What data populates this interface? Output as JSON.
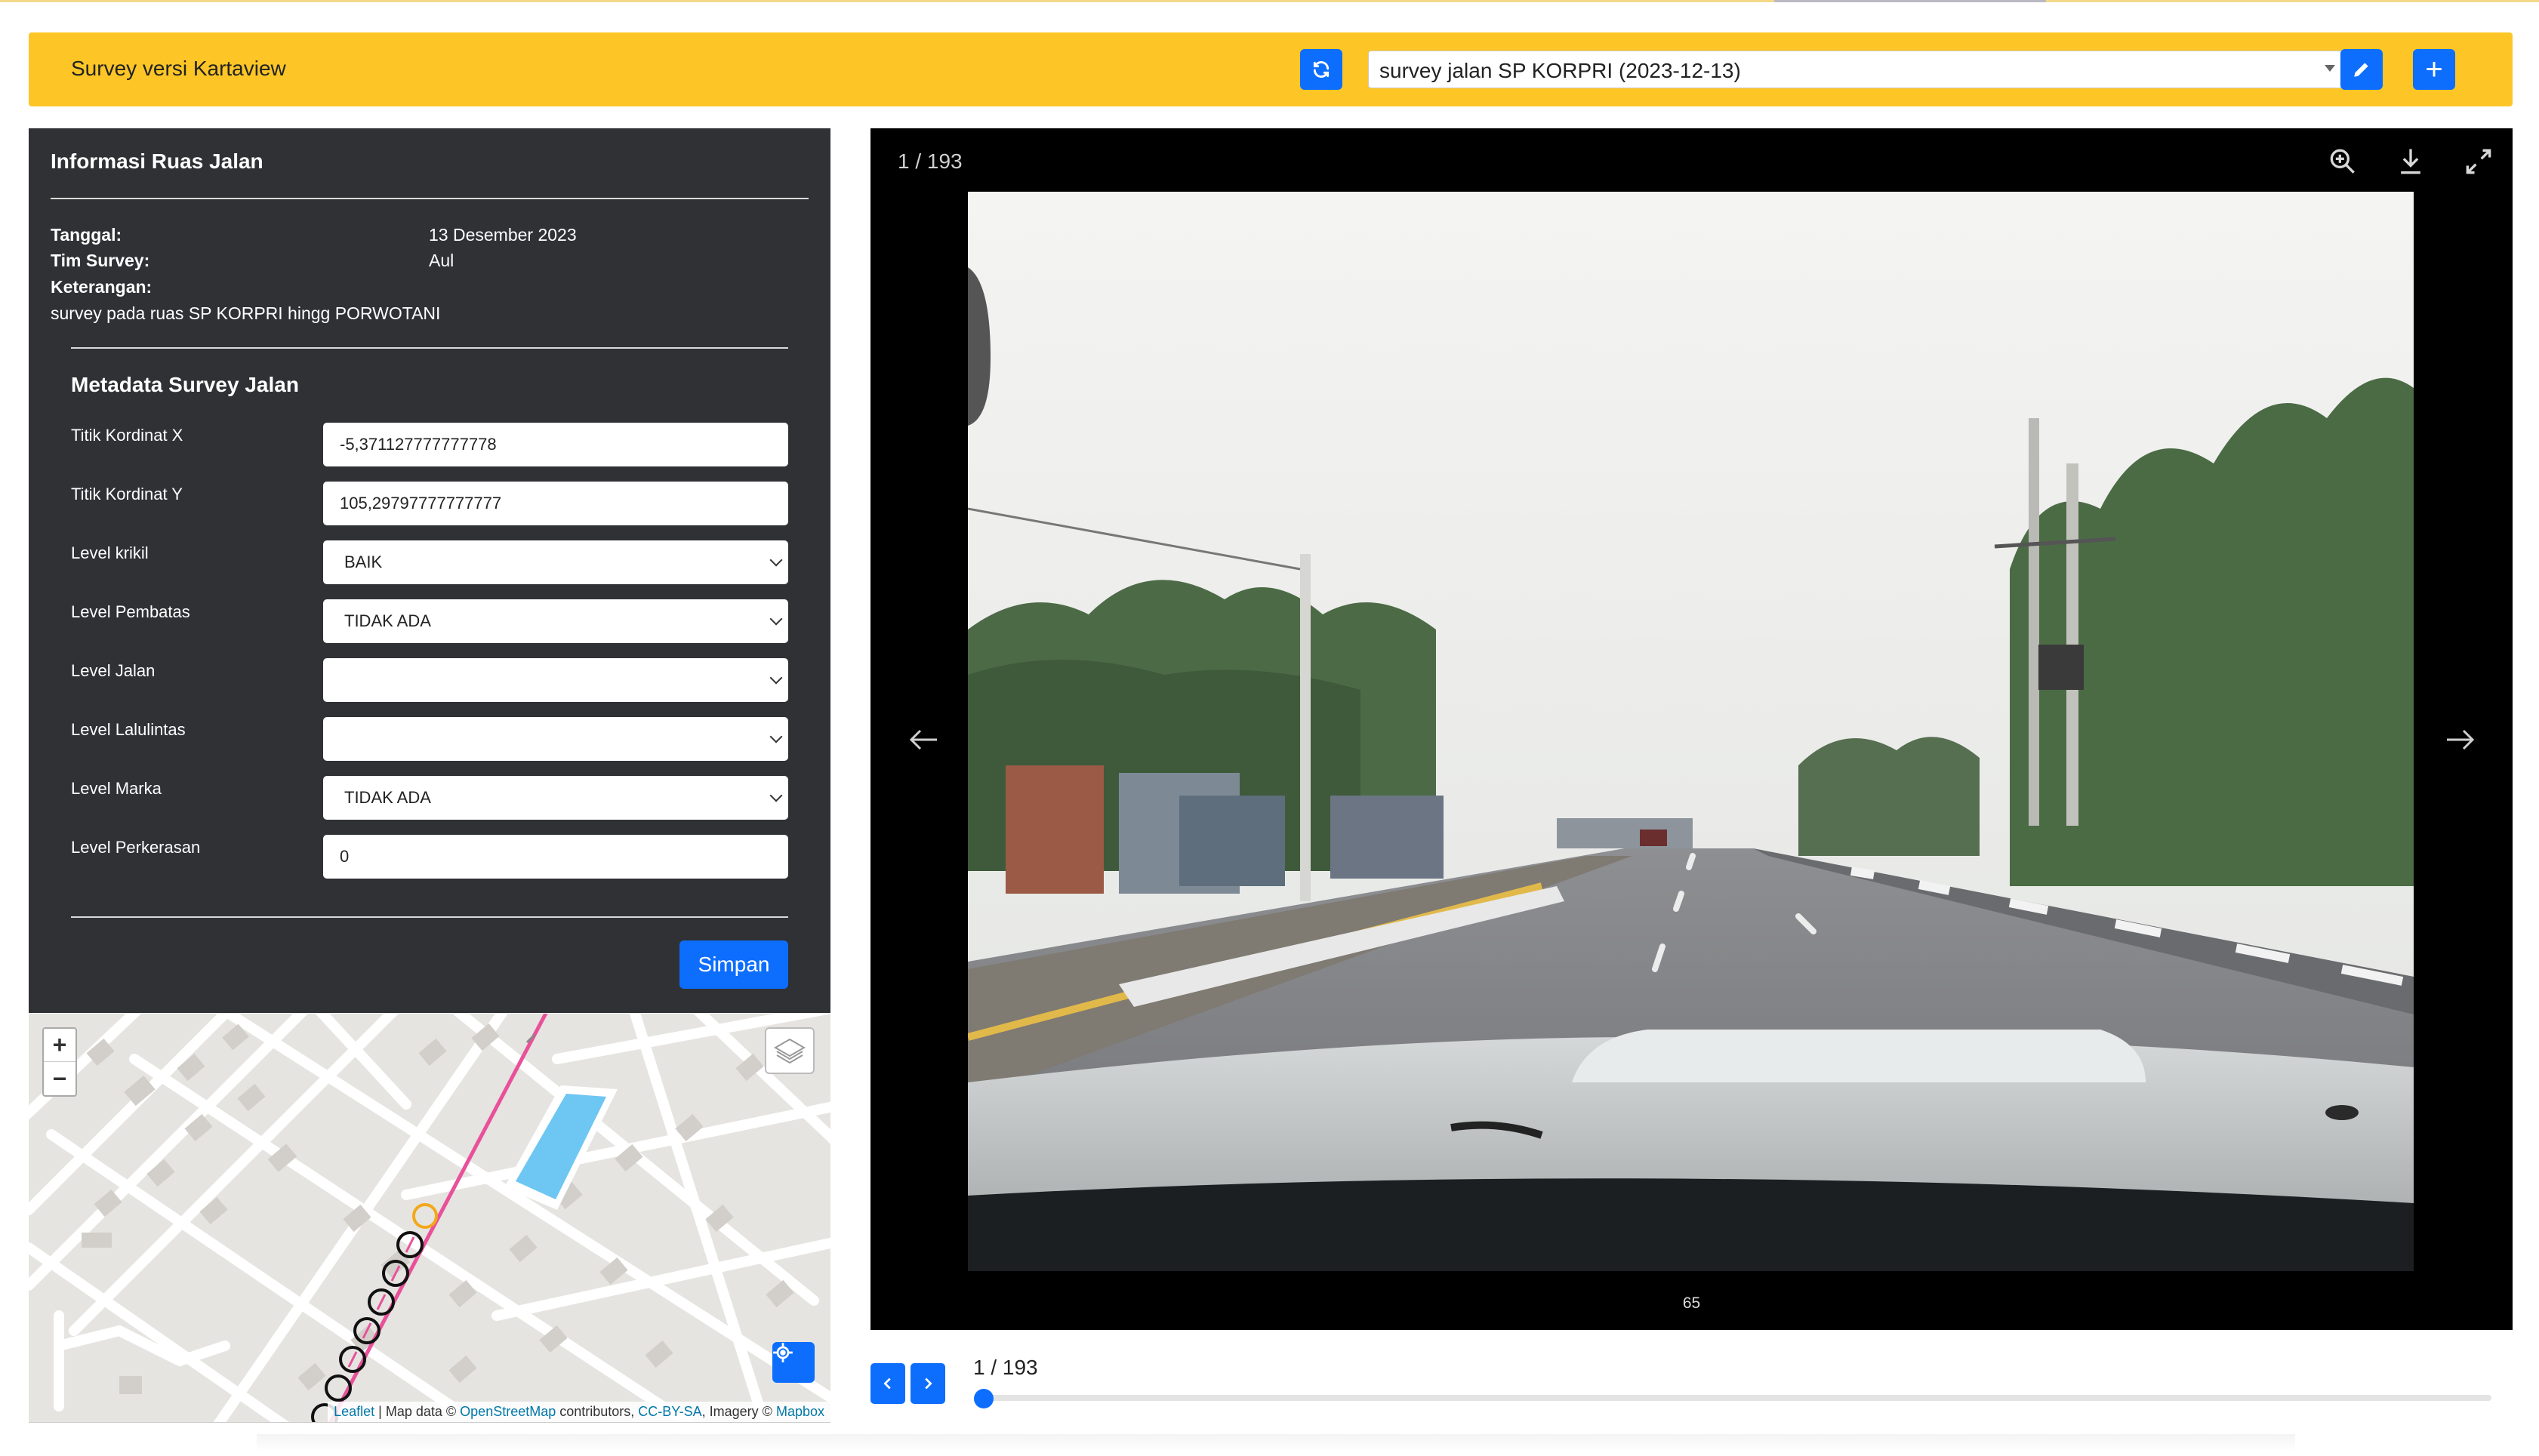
{
  "header": {
    "title": "Survey versi Kartaview",
    "survey_select": "survey jalan SP KORPRI (2023-12-13)",
    "add_label": "+"
  },
  "info": {
    "title": "Informasi Ruas Jalan",
    "tanggal_label": "Tanggal:",
    "tanggal_value": "13 Desember 2023",
    "tim_label": "Tim Survey:",
    "tim_value": "Aul",
    "keterangan_label": "Keterangan:",
    "keterangan_value": "survey pada ruas SP KORPRI hingg PORWOTANI"
  },
  "metadata": {
    "title": "Metadata Survey Jalan",
    "fields": [
      {
        "label": "Titik Kordinat X",
        "value": "-5,371127777777778"
      },
      {
        "label": "Titik Kordinat Y",
        "value": "105,29797777777777"
      },
      {
        "label": "Level krikil",
        "value": "BAIK"
      },
      {
        "label": "Level Pembatas",
        "value": "TIDAK ADA"
      },
      {
        "label": "Level Jalan",
        "value": ""
      },
      {
        "label": "Level Lalulintas",
        "value": ""
      },
      {
        "label": "Level Marka",
        "value": "TIDAK ADA"
      },
      {
        "label": "Level Perkerasan",
        "value": "0"
      }
    ],
    "save_label": "Simpan"
  },
  "map": {
    "zoom_in": "+",
    "zoom_out": "−",
    "attribution": {
      "leaflet": "Leaflet",
      "text1": " | Map data © ",
      "osm": "OpenStreetMap",
      "text2": " contributors, ",
      "license": "CC-BY-SA",
      "text3": ", Imagery © ",
      "mapbox": "Mapbox"
    }
  },
  "viewer": {
    "counter": "1 / 193",
    "caption": "65"
  },
  "slider": {
    "label": "1 / 193",
    "position": 0
  },
  "colors": {
    "header": "#fdc626",
    "primary": "#0d6efd",
    "panel": "#303135"
  }
}
